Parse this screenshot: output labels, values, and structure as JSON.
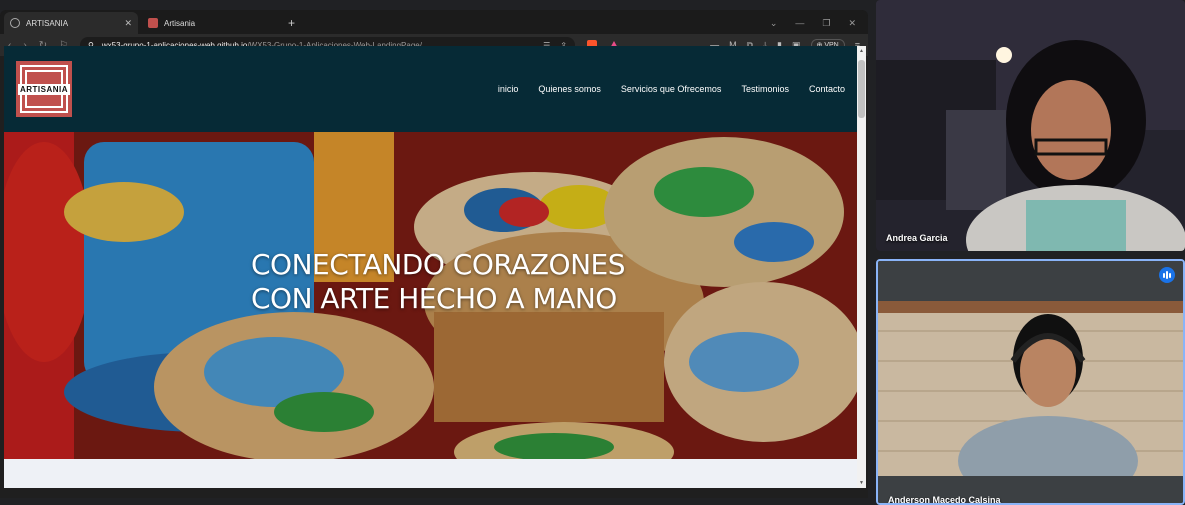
{
  "browser": {
    "tabs": [
      {
        "label": "ARTISANIA",
        "active": true,
        "icon": "globe-icon"
      },
      {
        "label": "Artisania",
        "active": false,
        "icon": "artisania-favicon"
      }
    ],
    "new_tab": "+",
    "url_host": "wx53-grupo-1-aplicaciones-web.github.io",
    "url_path": "/WX53-Grupo-1-Aplicaciones-Web-LandingPage/",
    "vpn_label": "VPN"
  },
  "site": {
    "logo_text": "ARTISANIA",
    "nav": [
      "inicio",
      "Quienes somos",
      "Servicios que Ofrecemos",
      "Testimonios",
      "Contacto"
    ],
    "hero_line1": "CONECTANDO CORAZONES",
    "hero_line2": "CON ARTE HECHO A MANO"
  },
  "meet": {
    "participant1": "Andrea Garcia",
    "participant2": "Anderson Macedo Calsina",
    "speaking_color": "#1a73e8"
  },
  "colors": {
    "header_bg": "#062a36",
    "logo_red": "#c0504d"
  }
}
